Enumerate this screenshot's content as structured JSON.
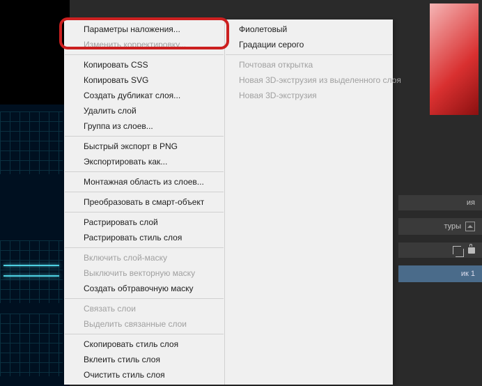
{
  "menu": {
    "main": [
      {
        "type": "item",
        "label": "Параметры наложения...",
        "enabled": true
      },
      {
        "type": "item",
        "label": "Изменить корректировку...",
        "enabled": false
      },
      {
        "type": "sep"
      },
      {
        "type": "item",
        "label": "Копировать CSS",
        "enabled": true
      },
      {
        "type": "item",
        "label": "Копировать SVG",
        "enabled": true
      },
      {
        "type": "item",
        "label": "Создать дубликат слоя...",
        "enabled": true
      },
      {
        "type": "item",
        "label": "Удалить слой",
        "enabled": true
      },
      {
        "type": "item",
        "label": "Группа из слоев...",
        "enabled": true
      },
      {
        "type": "sep"
      },
      {
        "type": "item",
        "label": "Быстрый экспорт в PNG",
        "enabled": true
      },
      {
        "type": "item",
        "label": "Экспортировать как...",
        "enabled": true
      },
      {
        "type": "sep"
      },
      {
        "type": "item",
        "label": "Монтажная область из слоев...",
        "enabled": true
      },
      {
        "type": "sep"
      },
      {
        "type": "item",
        "label": "Преобразовать в смарт-объект",
        "enabled": true
      },
      {
        "type": "sep"
      },
      {
        "type": "item",
        "label": "Растрировать слой",
        "enabled": true
      },
      {
        "type": "item",
        "label": "Растрировать стиль слоя",
        "enabled": true
      },
      {
        "type": "sep"
      },
      {
        "type": "item",
        "label": "Включить слой-маску",
        "enabled": false
      },
      {
        "type": "item",
        "label": "Выключить векторную маску",
        "enabled": false
      },
      {
        "type": "item",
        "label": "Создать обтравочную маску",
        "enabled": true
      },
      {
        "type": "sep"
      },
      {
        "type": "item",
        "label": "Связать слои",
        "enabled": false
      },
      {
        "type": "item",
        "label": "Выделить связанные слои",
        "enabled": false
      },
      {
        "type": "sep"
      },
      {
        "type": "item",
        "label": "Скопировать стиль слоя",
        "enabled": true
      },
      {
        "type": "item",
        "label": "Вклеить стиль слоя",
        "enabled": true
      },
      {
        "type": "item",
        "label": "Очистить стиль слоя",
        "enabled": true
      }
    ],
    "sub": [
      {
        "type": "item",
        "label": "Фиолетовый",
        "enabled": true
      },
      {
        "type": "item",
        "label": "Градации серого",
        "enabled": true
      },
      {
        "type": "sep"
      },
      {
        "type": "item",
        "label": "Почтовая открытка",
        "enabled": false
      },
      {
        "type": "item",
        "label": "Новая 3D-экструзия из выделенного слоя",
        "enabled": false
      },
      {
        "type": "item",
        "label": "Новая 3D-экструзия",
        "enabled": false
      }
    ]
  },
  "panels": {
    "tab1": "ия",
    "tab2": "туры",
    "layer": "ик 1"
  },
  "icons": {
    "crop": "crop-icon",
    "lock": "lock-icon",
    "image": "image-icon"
  }
}
